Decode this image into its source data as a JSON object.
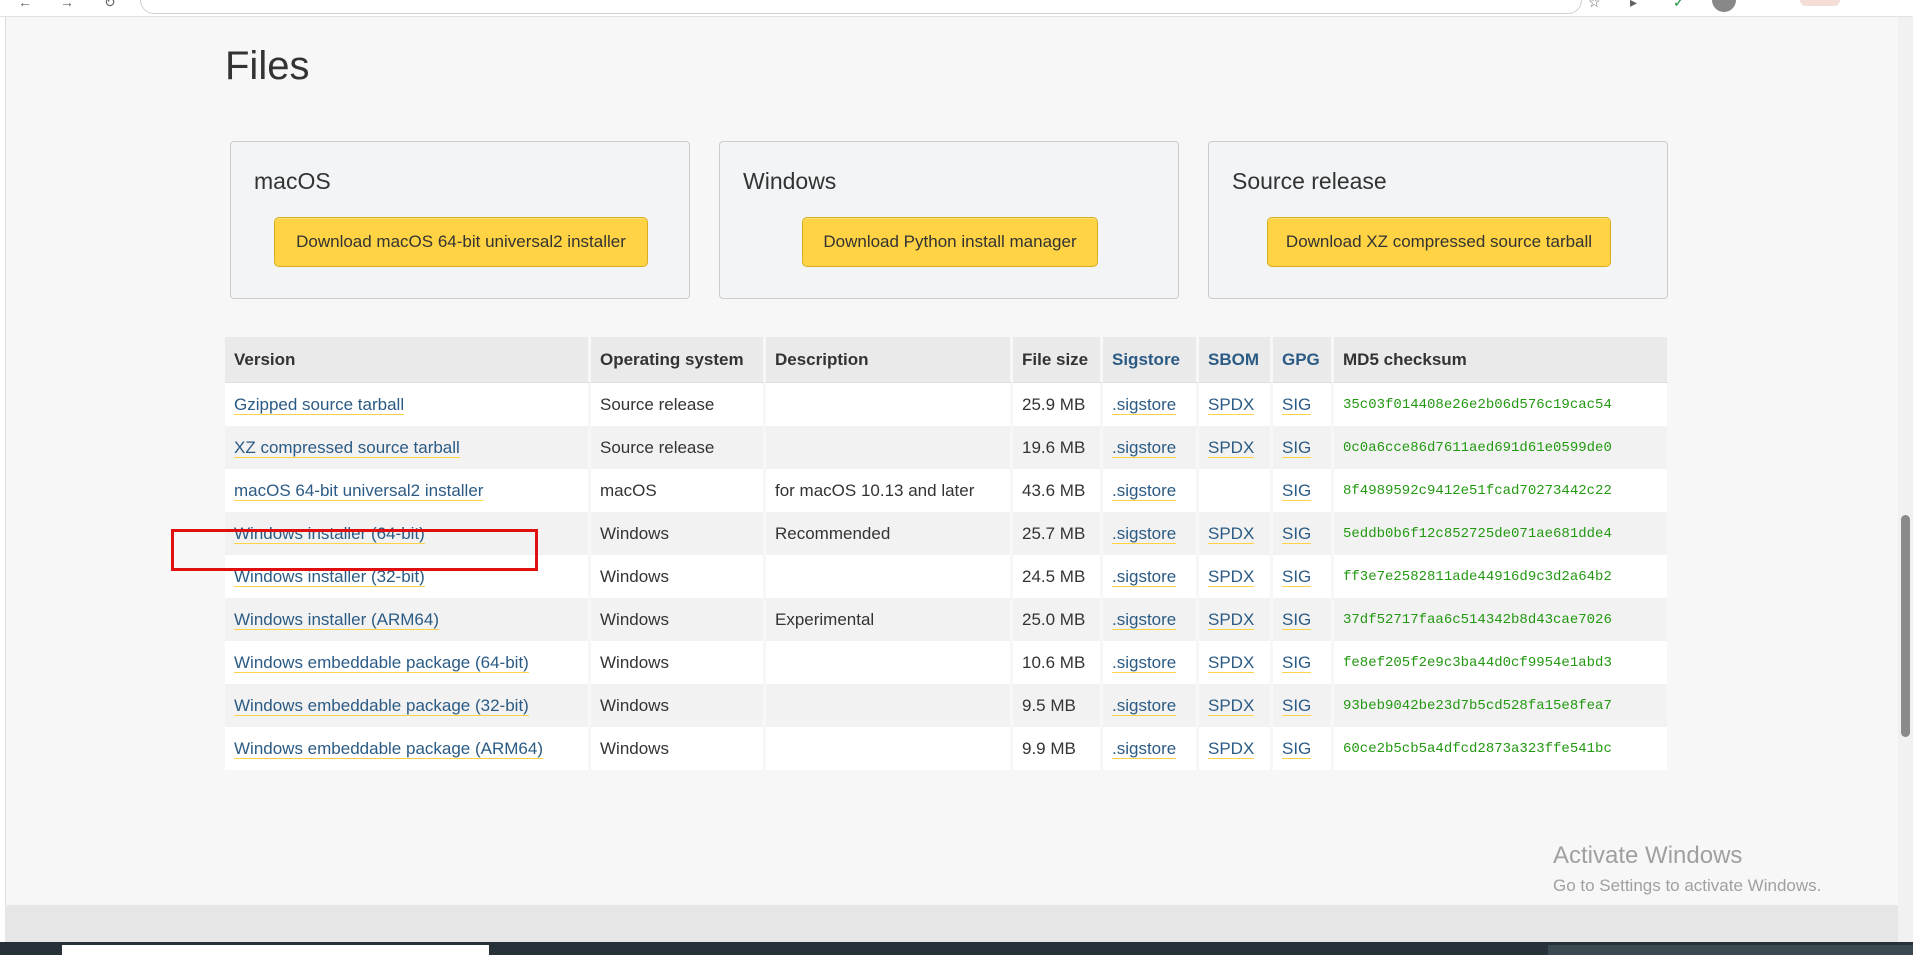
{
  "files_title": "Files",
  "cards": [
    {
      "title": "macOS",
      "button": "Download macOS 64-bit universal2 installer"
    },
    {
      "title": "Windows",
      "button": "Download Python install manager"
    },
    {
      "title": "Source release",
      "button": "Download XZ compressed source tarball"
    }
  ],
  "table": {
    "headers": [
      "Version",
      "Operating system",
      "Description",
      "File size",
      "Sigstore",
      "SBOM",
      "GPG",
      "MD5 checksum"
    ],
    "rows": [
      {
        "version": "Gzipped source tarball",
        "os": "Source release",
        "desc": "",
        "size": "25.9 MB",
        "sigstore": ".sigstore",
        "sbom": "SPDX",
        "gpg": "SIG",
        "md5": "35c03f014408e26e2b06d576c19cac54"
      },
      {
        "version": "XZ compressed source tarball",
        "os": "Source release",
        "desc": "",
        "size": "19.6 MB",
        "sigstore": ".sigstore",
        "sbom": "SPDX",
        "gpg": "SIG",
        "md5": "0c0a6cce86d7611aed691d61e0599de0"
      },
      {
        "version": "macOS 64-bit universal2 installer",
        "os": "macOS",
        "desc": "for macOS 10.13 and later",
        "size": "43.6 MB",
        "sigstore": ".sigstore",
        "sbom": "",
        "gpg": "SIG",
        "md5": "8f4989592c9412e51fcad70273442c22"
      },
      {
        "version": "Windows installer (64-bit)",
        "os": "Windows",
        "desc": "Recommended",
        "size": "25.7 MB",
        "sigstore": ".sigstore",
        "sbom": "SPDX",
        "gpg": "SIG",
        "md5": "5eddb0b6f12c852725de071ae681dde4"
      },
      {
        "version": "Windows installer (32-bit)",
        "os": "Windows",
        "desc": "",
        "size": "24.5 MB",
        "sigstore": ".sigstore",
        "sbom": "SPDX",
        "gpg": "SIG",
        "md5": "ff3e7e2582811ade44916d9c3d2a64b2"
      },
      {
        "version": "Windows installer (ARM64)",
        "os": "Windows",
        "desc": "Experimental",
        "size": "25.0 MB",
        "sigstore": ".sigstore",
        "sbom": "SPDX",
        "gpg": "SIG",
        "md5": "37df52717faa6c514342b8d43cae7026"
      },
      {
        "version": "Windows embeddable package (64-bit)",
        "os": "Windows",
        "desc": "",
        "size": "10.6 MB",
        "sigstore": ".sigstore",
        "sbom": "SPDX",
        "gpg": "SIG",
        "md5": "fe8ef205f2e9c3ba44d0cf9954e1abd3"
      },
      {
        "version": "Windows embeddable package (32-bit)",
        "os": "Windows",
        "desc": "",
        "size": "9.5 MB",
        "sigstore": ".sigstore",
        "sbom": "SPDX",
        "gpg": "SIG",
        "md5": "93beb9042be23d7b5cd528fa15e8fea7"
      },
      {
        "version": "Windows embeddable package (ARM64)",
        "os": "Windows",
        "desc": "",
        "size": "9.9 MB",
        "sigstore": ".sigstore",
        "sbom": "SPDX",
        "gpg": "SIG",
        "md5": "60ce2b5cb5a4dfcd2873a323ffe541bc"
      }
    ]
  },
  "watermark": {
    "line1": "Activate Windows",
    "line2": "Go to Settings to activate Windows."
  },
  "colors": {
    "button": "#ffd343",
    "link": "#2b5b84",
    "checksum": "#229911",
    "highlight": "#e01010"
  }
}
